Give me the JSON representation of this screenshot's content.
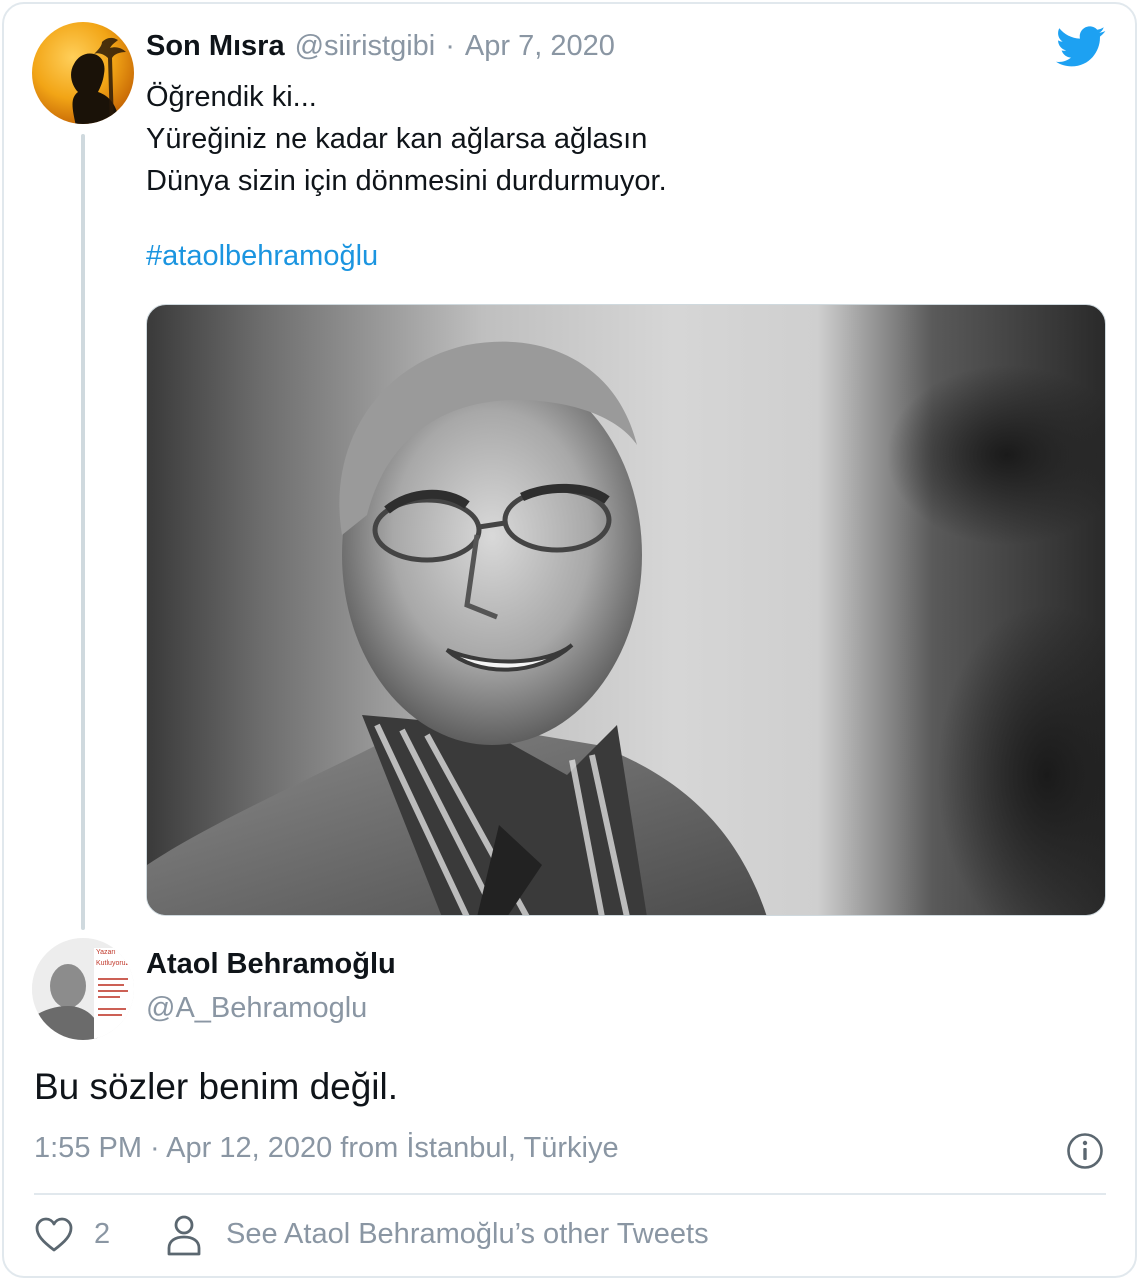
{
  "quoted_tweet": {
    "author_name": "Son Mısra",
    "author_handle": "@siiristgibi",
    "separator": "·",
    "date": "Apr 7, 2020",
    "text_lines": [
      "Öğrendik ki...",
      "Yüreğiniz ne kadar kan ağlarsa ağlasın",
      "Dünya sizin için dönmesini durdurmuyor."
    ],
    "hashtag": "#ataolbehramoğlu",
    "avatar_icon": "silhouette-avatar",
    "photo_icon": "black-and-white-portrait-photo"
  },
  "main_tweet": {
    "author_name": "Ataol Behramoğlu",
    "author_handle": "@A_Behramoglu",
    "text": "Bu sözler benim değil.",
    "timestamp_line": "1:55 PM · Apr 12, 2020 from İstanbul, Türkiye",
    "avatar_icon": "profile-photo-avatar",
    "avatar_text_lines": [
      "Yazarı",
      "Kutluyoruz"
    ]
  },
  "actions": {
    "like_count": "2",
    "see_more_label": "See Ataol Behramoğlu’s other Tweets",
    "like_icon": "heart-icon",
    "profile_icon": "person-icon",
    "info_icon": "info-icon"
  },
  "brand": {
    "logo_icon": "twitter-bird-icon",
    "accent_color": "#1DA1F2",
    "link_color": "#1B95E0",
    "muted_text_color": "#8A96A3"
  }
}
